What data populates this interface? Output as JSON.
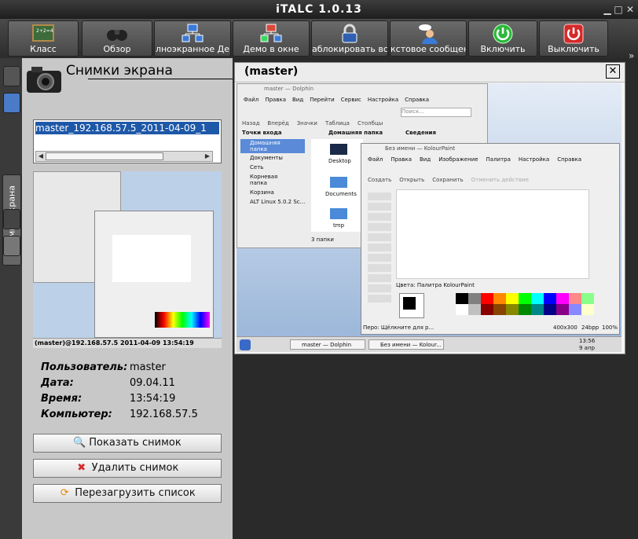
{
  "window": {
    "title": "iTALC 1.0.13"
  },
  "toolbar": {
    "buttons": [
      {
        "label": "Класс"
      },
      {
        "label": "Обзор"
      },
      {
        "label": "лноэкранное Де"
      },
      {
        "label": "Демо в окне"
      },
      {
        "label": "аблокировать вс"
      },
      {
        "label": "кстовое сообщен"
      },
      {
        "label": "Включить"
      },
      {
        "label": "Выключить"
      }
    ],
    "more": "»"
  },
  "sidebar": {
    "tab_label": "Снимки экрана"
  },
  "panel": {
    "title": "Снимки экрана",
    "selected_item": "master_192.168.57.5_2011-04-09_1",
    "thumbnail_caption": "(master)@192.168.57.5 2011-04-09 13:54:19",
    "info": {
      "user_label": "Пользователь:",
      "user_value": "master",
      "date_label": "Дата:",
      "date_value": "09.04.11",
      "time_label": "Время:",
      "time_value": "13:54:19",
      "computer_label": "Компьютер:",
      "computer_value": "192.168.57.5"
    },
    "buttons": {
      "show": "Показать снимок",
      "delete": "Удалить снимок",
      "reload": "Перезагрузить список"
    }
  },
  "screenshot": {
    "title": "(master)",
    "dolphin": {
      "title": "master — Dolphin",
      "menu": [
        "Файл",
        "Правка",
        "Вид",
        "Перейти",
        "Сервис",
        "Настройка",
        "Справка"
      ],
      "tools": [
        "Назад",
        "Вперёд",
        "Значки",
        "Таблица",
        "Столбцы"
      ],
      "search_placeholder": "Поиск...",
      "places_header": "Точки входа",
      "places": [
        "Домашняя папка",
        "Документы",
        "Сеть",
        "Корневая папка",
        "Корзина",
        "ALT Linux 5.0.2 Sc..."
      ],
      "location": "Домашняя папка",
      "folders": [
        "Desktop",
        "Documents",
        "tmp"
      ],
      "status": "3 папки",
      "info_header": "Сведения"
    },
    "kolour": {
      "title": "Без имени — KolourPaint",
      "menu": [
        "Файл",
        "Правка",
        "Вид",
        "Изображение",
        "Палитра",
        "Настройка",
        "Справка"
      ],
      "tools": [
        "Создать",
        "Открыть",
        "Сохранить",
        "Отменить действие"
      ],
      "palette_label": "Цвета: Палитра KolourPaint",
      "status_left": "Перо: Щёлкните для р...",
      "status_size": "400x300",
      "status_bpp": "24bpp",
      "status_zoom": "100%"
    },
    "taskbar": {
      "items": [
        "master — Dolphin",
        "Без имени — Kolour..."
      ],
      "time": "13:56",
      "date": "9 апр"
    }
  },
  "colors": {
    "accent": "#1e58a8",
    "panel_bg": "#c8c8c8",
    "main_bg": "#2a2a2a"
  }
}
